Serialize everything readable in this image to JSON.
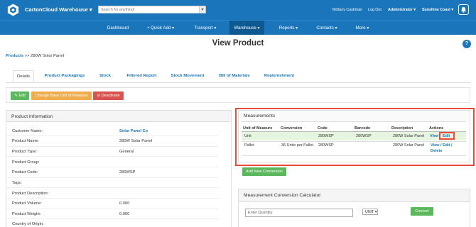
{
  "app": {
    "brand": "CartonCloud Warehouse",
    "search_placeholder": "Search for anything!",
    "user": "Brittany Cashman",
    "logout": "Log Out",
    "role": "Administrator",
    "location": "Sunshine Coast"
  },
  "nav": {
    "items": [
      "Dashboard",
      "+ Quick Add",
      "Transport",
      "Warehouse",
      "Reports",
      "Contacts",
      "More"
    ],
    "active": "Warehouse"
  },
  "breadcrumb": {
    "parent": "Products",
    "separator": ">>",
    "current": "280W Solar Panel"
  },
  "page": {
    "title": "View Product",
    "help": "?"
  },
  "tabs": [
    "Details",
    "Product Packagings",
    "Stock",
    "Filtered Report",
    "Stock Movement",
    "Bill of Materials",
    "Replenishment"
  ],
  "actions": {
    "edit": "Edit",
    "change_unit": "Change Base Unit of Measure",
    "deactivate": "Deactivate"
  },
  "product_info": {
    "title": "Product Information",
    "rows": [
      {
        "label": "Customer Name:",
        "value": "Solar Panel Co"
      },
      {
        "label": "Product Name:",
        "value": "280W Solar Panel"
      },
      {
        "label": "Product Type:",
        "value": "General"
      },
      {
        "label": "Product Group:",
        "value": ""
      },
      {
        "label": "Product Code:",
        "value": "280WSP"
      },
      {
        "label": "Tags:",
        "value": ""
      },
      {
        "label": "Product Description:",
        "value": ""
      },
      {
        "label": "Product Volume:",
        "value": "0.000"
      },
      {
        "label": "Product Weight:",
        "value": "0.000"
      },
      {
        "label": "Country of Origin:",
        "value": ""
      }
    ]
  },
  "measurements": {
    "title": "Measurements",
    "columns": [
      "Unit of Measure",
      "Conversion",
      "Code",
      "Barcode",
      "Description",
      "Actions"
    ],
    "rows": [
      {
        "unit": "Unit",
        "conversion": "",
        "code": "280WSP",
        "barcode": "280WSP",
        "description": "280W Solar Panel",
        "view": "View",
        "edit": "Edit"
      },
      {
        "unit": "Pallet",
        "conversion": "36 Units per Pallet",
        "code": "280WSP",
        "barcode": "",
        "description": "280W Solar Panel",
        "view": "View /",
        "edit": "Edit /",
        "delete": "Delete"
      }
    ],
    "add_button": "Add New Conversion"
  },
  "calculator": {
    "title": "Measurement Conversion Calculator",
    "quantity_placeholder": "Enter Quantity",
    "unit": "UNIT",
    "convert_button": "Convert"
  },
  "colors": {
    "brand": "#1a75bb",
    "nav_active": "#0d5a92",
    "success": "#5cb85c",
    "warning": "#f0ad4e",
    "danger": "#d9534f",
    "highlight": "#e74c3c"
  }
}
